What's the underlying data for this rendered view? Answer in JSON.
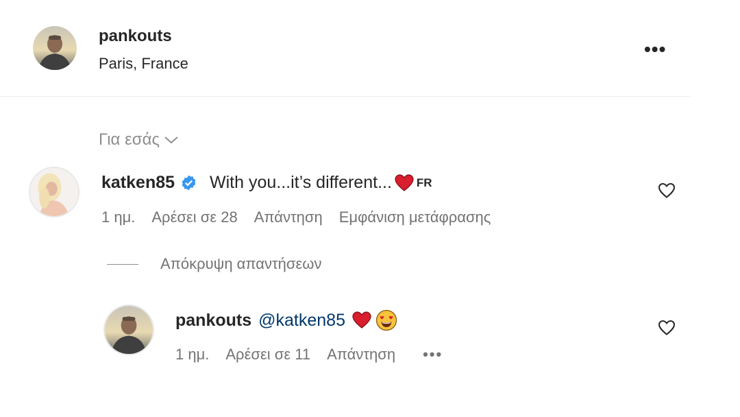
{
  "header": {
    "username": "pankouts",
    "location": "Paris, France",
    "more_label": "•••"
  },
  "filter": {
    "label": "Για εσάς"
  },
  "comment": {
    "username": "katken85",
    "text": "With you...it’s different...",
    "lang_tag": "FR",
    "time": "1 ημ.",
    "likes": "Αρέσει σε 28",
    "reply_label": "Απάντηση",
    "translate_label": "Εμφάνιση μετάφρασης"
  },
  "hide_replies_label": "Απόκρυψη απαντήσεων",
  "reply": {
    "username": "pankouts",
    "mention": "@katken85",
    "time": "1 ημ.",
    "likes": "Αρέσει σε 11",
    "reply_label": "Απάντηση",
    "more_label": "•••"
  },
  "colors": {
    "verified": "#3897f0",
    "heart": "#ed4956",
    "mention": "#00376b",
    "muted": "#737373"
  },
  "icons": [
    "verified-badge-icon",
    "heart-emoji-icon",
    "heart-eyes-emoji-icon",
    "like-heart-icon",
    "chevron-down-icon",
    "more-options-icon"
  ]
}
